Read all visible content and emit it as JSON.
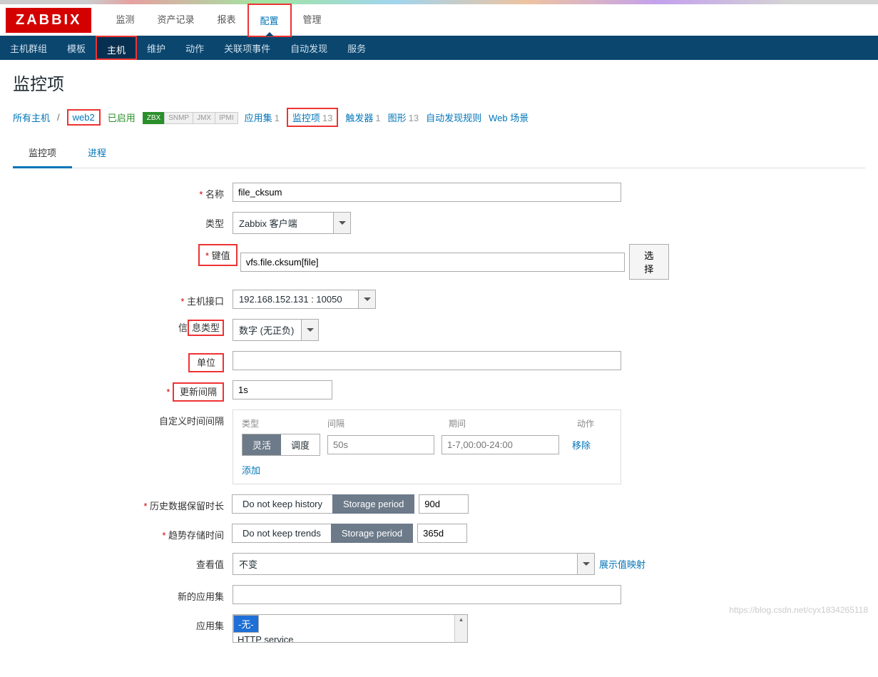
{
  "logo": "ZABBIX",
  "mainnav": {
    "items": [
      "监测",
      "资产记录",
      "报表",
      "配置",
      "管理"
    ],
    "active": "配置"
  },
  "subnav": {
    "items": [
      "主机群组",
      "模板",
      "主机",
      "维护",
      "动作",
      "关联项事件",
      "自动发现",
      "服务"
    ],
    "active": "主机"
  },
  "page_title": "监控项",
  "breadcrumb": {
    "all_hosts": "所有主机",
    "host": "web2",
    "enabled": "已启用",
    "pills": {
      "zbx": "ZBX",
      "snmp": "SNMP",
      "jmx": "JMX",
      "ipmi": "IPMI"
    },
    "app": {
      "label": "应用集",
      "count": "1"
    },
    "items": {
      "label": "监控项",
      "count": "13"
    },
    "triggers": {
      "label": "触发器",
      "count": "1"
    },
    "graphs": {
      "label": "图形",
      "count": "13"
    },
    "discovery": "自动发现规则",
    "web": "Web 场景"
  },
  "tabs": {
    "items": "监控项",
    "process": "进程"
  },
  "form": {
    "name": {
      "label": "名称",
      "value": "file_cksum"
    },
    "type": {
      "label": "类型",
      "value": "Zabbix 客户端"
    },
    "key": {
      "label": "键值",
      "value": "vfs.file.cksum[file]",
      "select_btn": "选择"
    },
    "interface": {
      "label": "主机接口",
      "value": "192.168.152.131 : 10050"
    },
    "info_type": {
      "label": "信息类型",
      "value": "数字 (无正负)"
    },
    "unit": {
      "label": "单位",
      "value": ""
    },
    "update": {
      "label": "更新间隔",
      "value": "1s"
    },
    "custom_int": {
      "label": "自定义时间间隔",
      "hdr_type": "类型",
      "hdr_int": "间隔",
      "hdr_period": "期间",
      "hdr_action": "动作",
      "toggle_flex": "灵活",
      "toggle_sched": "调度",
      "int_ph": "50s",
      "period_ph": "1-7,00:00-24:00",
      "remove": "移除",
      "add": "添加"
    },
    "history": {
      "label": "历史数据保留时长",
      "nokeep": "Do not keep history",
      "storage": "Storage period",
      "value": "90d"
    },
    "trends": {
      "label": "趋势存储时间",
      "nokeep": "Do not keep trends",
      "storage": "Storage period",
      "value": "365d"
    },
    "show_value": {
      "label": "查看值",
      "value": "不变",
      "link": "展示值映射"
    },
    "new_app": {
      "label": "新的应用集",
      "value": ""
    },
    "apps": {
      "label": "应用集",
      "opt_none": "-无-",
      "opt_http": "HTTP service"
    }
  },
  "watermark": "https://blog.csdn.net/cyx1834265118"
}
